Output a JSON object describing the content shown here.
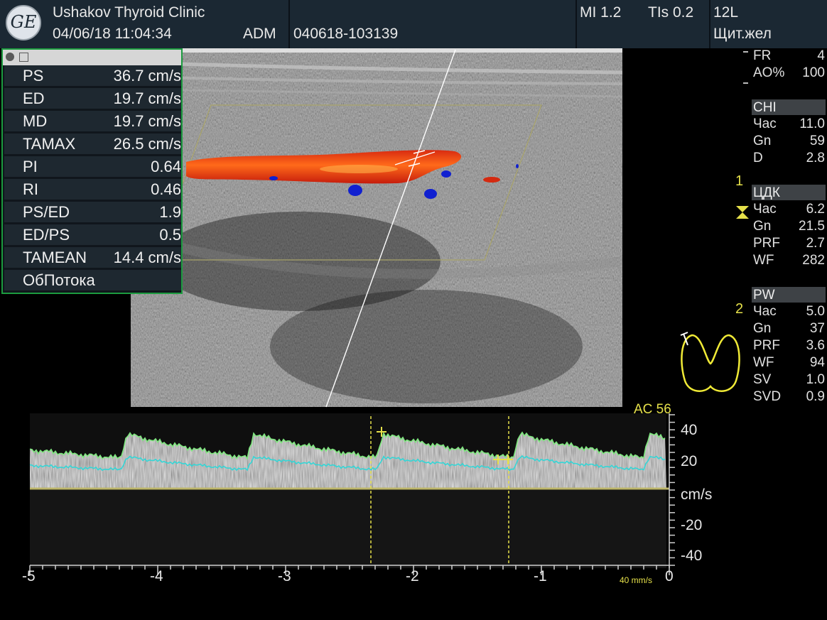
{
  "header": {
    "logo_text": "GE",
    "clinic": "Ushakov Thyroid Clinic",
    "datetime": "04/06/18 11:04:34",
    "operator": "ADM",
    "exam_id": "040618-103139",
    "mi": "MI 1.2",
    "tis": "TIs 0.2",
    "probe": "12L",
    "preset": "Щит.жел"
  },
  "measurements": [
    {
      "label": "PS",
      "value": "36.7 cm/s"
    },
    {
      "label": "ED",
      "value": "19.7 cm/s"
    },
    {
      "label": "MD",
      "value": "19.7 cm/s"
    },
    {
      "label": "TAMAX",
      "value": "26.5 cm/s"
    },
    {
      "label": "PI",
      "value": "0.64"
    },
    {
      "label": "RI",
      "value": "0.46"
    },
    {
      "label": "PS/ED",
      "value": "1.9"
    },
    {
      "label": "ED/PS",
      "value": "0.5"
    },
    {
      "label": "TAMEAN",
      "value": "14.4 cm/s"
    },
    {
      "label": "ОбПотока",
      "value": ""
    }
  ],
  "right_panel": {
    "top": [
      {
        "k": "FR",
        "v": "4"
      },
      {
        "k": "AO%",
        "v": "100"
      }
    ],
    "chi": {
      "title": "CHI",
      "rows": [
        {
          "k": "Час",
          "v": "11.0"
        },
        {
          "k": "Gn",
          "v": "59"
        },
        {
          "k": "D",
          "v": "2.8"
        }
      ]
    },
    "cdk": {
      "title": "ЦДК",
      "rows": [
        {
          "k": "Час",
          "v": "6.2"
        },
        {
          "k": "Gn",
          "v": "21.5"
        },
        {
          "k": "PRF",
          "v": "2.7"
        },
        {
          "k": "WF",
          "v": "282"
        }
      ]
    },
    "pw": {
      "title": "PW",
      "rows": [
        {
          "k": "Час",
          "v": "5.0"
        },
        {
          "k": "Gn",
          "v": "37"
        },
        {
          "k": "PRF",
          "v": "3.6"
        },
        {
          "k": "WF",
          "v": "94"
        },
        {
          "k": "SV",
          "v": "1.0"
        },
        {
          "k": "SVD",
          "v": "0.9"
        }
      ]
    },
    "focus_marker_1": "1",
    "focus_marker_2": "2"
  },
  "spectral": {
    "ac_label": "AC 56",
    "unit": "cm/s",
    "y_ticks": [
      "40",
      "20",
      "-20",
      "-40"
    ],
    "x_ticks": [
      "-5",
      "-4",
      "-3",
      "-2",
      "-1",
      "0"
    ],
    "sweep_speed": "40 mm/s"
  },
  "colors": {
    "header_bg": "#1b2833",
    "panel_border": "#1c9b3f",
    "annotation_yellow": "#e5e04a",
    "envelope_max": "#7ee87e",
    "envelope_mean": "#33d6d6",
    "color_doppler_red": "#ee3a12",
    "color_doppler_blue": "#1020d0"
  }
}
